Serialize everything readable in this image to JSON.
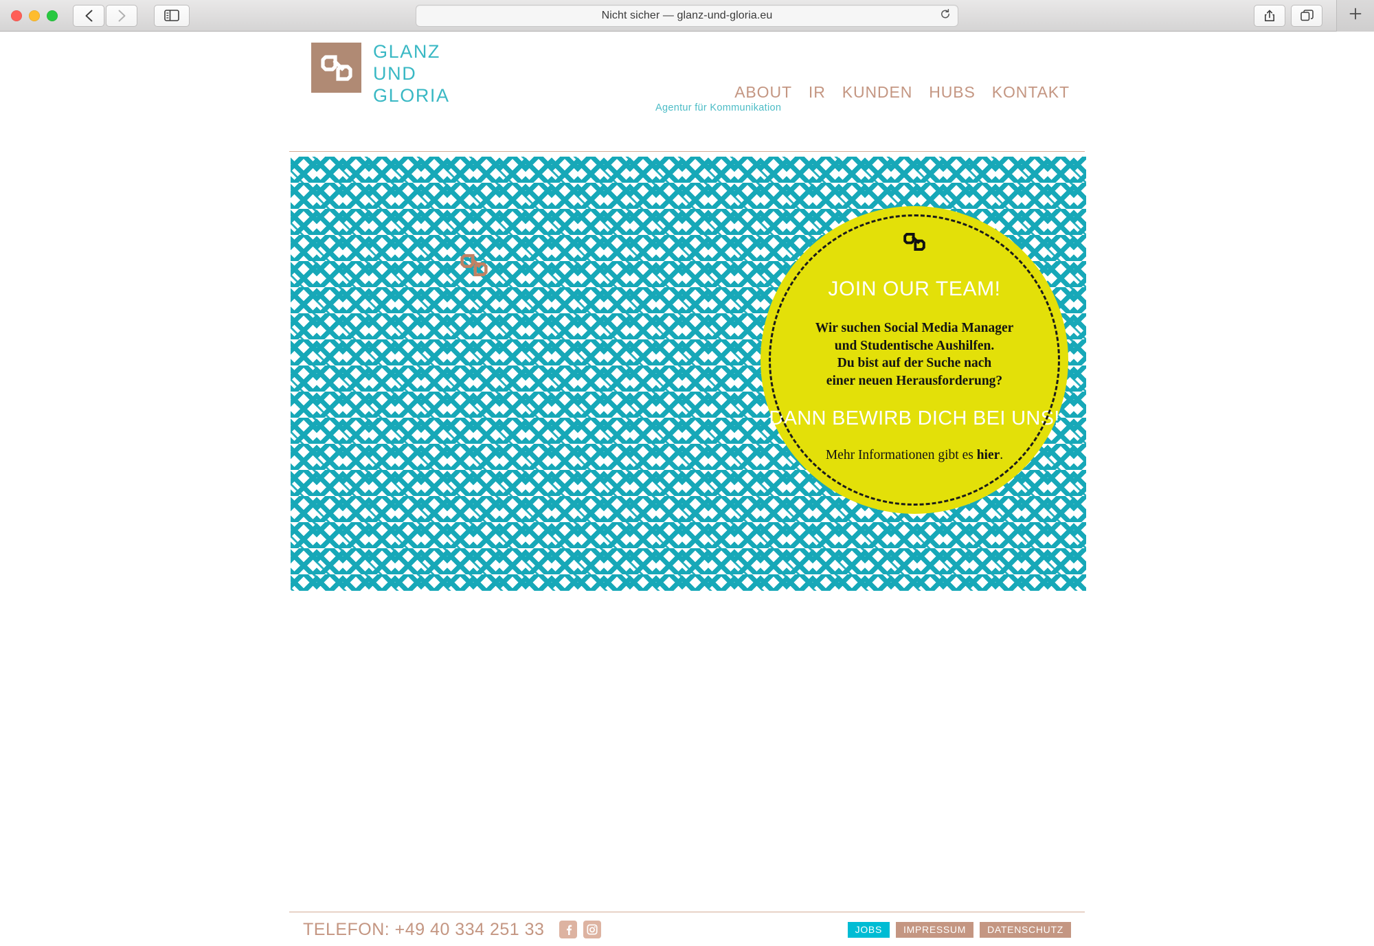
{
  "browser": {
    "window_controls": [
      "close",
      "minimize",
      "maximize"
    ],
    "back_icon": "chevron-left-icon",
    "forward_icon": "chevron-right-icon",
    "sidebar_icon": "sidebar-toggle-icon",
    "url_text": "Nicht sicher — glanz-und-gloria.eu",
    "reload_icon": "reload-icon",
    "share_icon": "share-icon",
    "tabs_icon": "tab-overview-icon",
    "new_tab_label": "+"
  },
  "header": {
    "logo_mark_icon": "chain-link-logo-icon",
    "logo_lines": [
      "GLANZ",
      "UND",
      "GLORIA"
    ],
    "tagline": "Agentur für Kommunikation",
    "nav": [
      {
        "label": "ABOUT"
      },
      {
        "label": "IR"
      },
      {
        "label": "KUNDEN"
      },
      {
        "label": "HUBS"
      },
      {
        "label": "KONTAKT"
      }
    ]
  },
  "hero": {
    "pattern_name": "interlocking-chain-pattern",
    "accent_icon": "chain-link-accent-icon",
    "badge": {
      "logo_icon": "chain-link-badge-icon",
      "headline": "JOIN OUR TEAM!",
      "body": "Wir suchen Social Media Manager\nund Studentische Aushilfen.\nDu bist auf der Suche nach\neiner neuen Herausforderung?",
      "subheadline": "DANN BEWIRB DICH BEI UNS!",
      "more_prefix": "Mehr Informationen gibt es ",
      "more_link": "hier",
      "more_suffix": "."
    }
  },
  "footer": {
    "phone": "TELEFON: +49 40 334 251 33",
    "socials": [
      {
        "name": "facebook-icon"
      },
      {
        "name": "instagram-icon"
      }
    ],
    "buttons": [
      {
        "label": "JOBS",
        "style": "jobs"
      },
      {
        "label": "IMPRESSUM",
        "style": "default"
      },
      {
        "label": "DATENSCHUTZ",
        "style": "default"
      }
    ]
  },
  "colors": {
    "teal": "#17a8b8",
    "logo_teal": "#39b8c4",
    "tan": "#c49682",
    "logo_brown": "#b08a74",
    "yellow": "#e3e009",
    "cyan": "#00bcd4",
    "rule": "#d3ab95"
  }
}
